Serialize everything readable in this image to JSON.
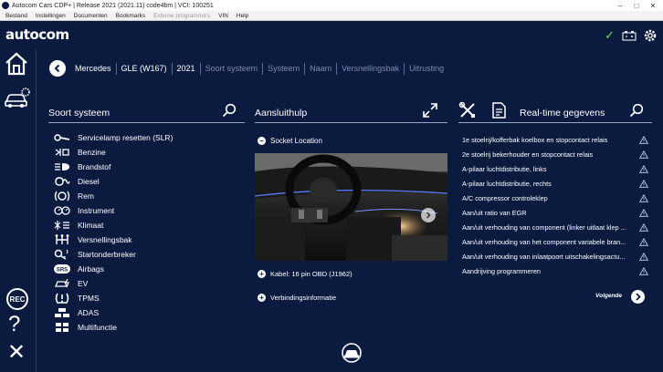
{
  "window": {
    "title": "Autocom Cars CDP+ | Release 2021 (2021.11) code4bm | VCI: 100251"
  },
  "menu": [
    {
      "label": "Bestand",
      "enabled": true
    },
    {
      "label": "Instellingen",
      "enabled": true
    },
    {
      "label": "Documenten",
      "enabled": true
    },
    {
      "label": "Bookmarks",
      "enabled": true
    },
    {
      "label": "Externe programma's",
      "enabled": false
    },
    {
      "label": "VIN",
      "enabled": true
    },
    {
      "label": "Help",
      "enabled": true
    }
  ],
  "logo": "autocom",
  "breadcrumb": [
    {
      "label": "Mercedes",
      "active": true
    },
    {
      "label": "GLE (W167)",
      "active": true
    },
    {
      "label": "2021",
      "active": true
    },
    {
      "label": "Soort systeem",
      "active": false
    },
    {
      "label": "Systeem",
      "active": false
    },
    {
      "label": "Naam",
      "active": false
    },
    {
      "label": "Versnellingsbak",
      "active": false
    },
    {
      "label": "Uitrusting",
      "active": false
    }
  ],
  "left_panel": {
    "title": "Soort systeem",
    "items": [
      {
        "label": "Servicelamp resetten (SLR)",
        "icon": "wrench-icon"
      },
      {
        "label": "Benzine",
        "icon": "fuel-injector-icon"
      },
      {
        "label": "Brandstof",
        "icon": "headlight-icon"
      },
      {
        "label": "Diesel",
        "icon": "glow-plug-icon"
      },
      {
        "label": "Rem",
        "icon": "brake-icon"
      },
      {
        "label": "Instrument",
        "icon": "instrument-cluster-icon"
      },
      {
        "label": "Klimaat",
        "icon": "climate-icon"
      },
      {
        "label": "Versnellingsbak",
        "icon": "gearbox-icon"
      },
      {
        "label": "Startonderbreker",
        "icon": "key-icon"
      },
      {
        "label": "Airbags",
        "icon": "airbag-icon"
      },
      {
        "label": "EV",
        "icon": "ev-icon"
      },
      {
        "label": "TPMS",
        "icon": "tpms-icon"
      },
      {
        "label": "ADAS",
        "icon": "adas-icon"
      },
      {
        "label": "Multifunctie",
        "icon": "multifunction-icon"
      }
    ]
  },
  "middle_panel": {
    "title": "Aansluithulp",
    "socket_label": "Socket Location",
    "cable_label": "Kabel: 16 pin OBD (J1962)",
    "connection_label": "Verbindingsinformatie"
  },
  "right_panel": {
    "title": "Real-time gegevens",
    "items": [
      "1e stoelrij/kofferbak koelbox en stopcontact relais",
      "2e stoelrij bekerhouder en stopcontact relais",
      "A-pilaar luchtdistributie, links",
      "A-pilaar luchtdistributie, rechts",
      "A/C compressor controleklep",
      "Aan/uit ratio van EGR",
      "Aan/uit verhouding van component (linker uitlaat klep ...",
      "Aan/uit verhouding van het component variabele bran...",
      "Aan/uit verhouding van inlaatpoort uitschakelingsactu...",
      "Aandrijving programmeren"
    ],
    "next_label": "Volgende"
  },
  "sidebar": {
    "rec_label": "REC"
  },
  "colors": {
    "background": "#0b1b40",
    "accent_check": "#7ed957"
  }
}
